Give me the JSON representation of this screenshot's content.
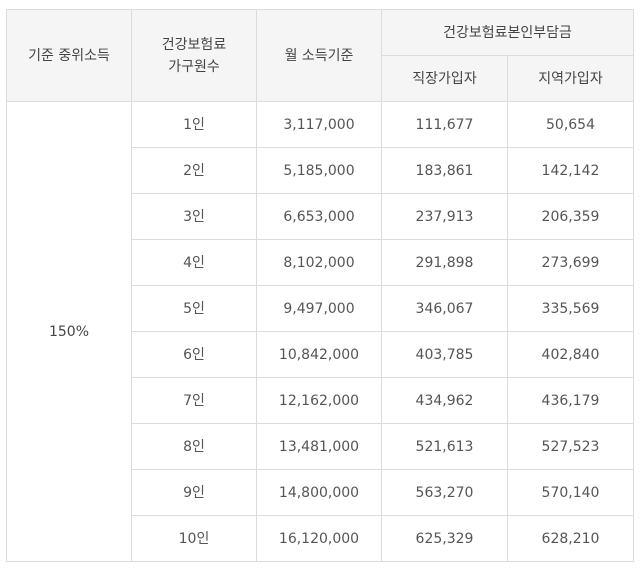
{
  "table": {
    "header": {
      "col_income": "기준 중위소득",
      "col_household_line1": "건강보험료",
      "col_household_line2": "가구원수",
      "col_monthly": "월 소득기준",
      "col_premium_group": "건강보험료본인부담금",
      "col_employee": "직장가입자",
      "col_regional": "지역가입자"
    },
    "income_level": "150%",
    "rows": [
      {
        "household": "1인",
        "monthly": "3,117,000",
        "employee": "111,677",
        "regional": "50,654"
      },
      {
        "household": "2인",
        "monthly": "5,185,000",
        "employee": "183,861",
        "regional": "142,142"
      },
      {
        "household": "3인",
        "monthly": "6,653,000",
        "employee": "237,913",
        "regional": "206,359"
      },
      {
        "household": "4인",
        "monthly": "8,102,000",
        "employee": "291,898",
        "regional": "273,699"
      },
      {
        "household": "5인",
        "monthly": "9,497,000",
        "employee": "346,067",
        "regional": "335,569"
      },
      {
        "household": "6인",
        "monthly": "10,842,000",
        "employee": "403,785",
        "regional": "402,840"
      },
      {
        "household": "7인",
        "monthly": "12,162,000",
        "employee": "434,962",
        "regional": "436,179"
      },
      {
        "household": "8인",
        "monthly": "13,481,000",
        "employee": "521,613",
        "regional": "527,523"
      },
      {
        "household": "9인",
        "monthly": "14,800,000",
        "employee": "563,270",
        "regional": "570,140"
      },
      {
        "household": "10인",
        "monthly": "16,120,000",
        "employee": "625,329",
        "regional": "628,210"
      }
    ]
  }
}
